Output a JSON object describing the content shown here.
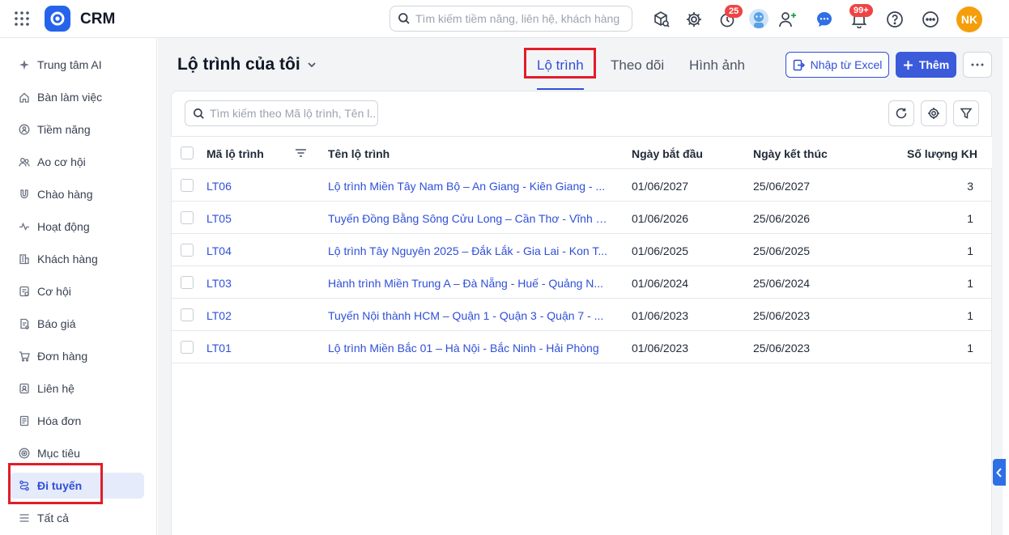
{
  "app": {
    "brand": "CRM"
  },
  "header": {
    "search_placeholder": "Tìm kiếm tiềm năng, liên hệ, khách hàng",
    "timer_badge": "25",
    "notification_badge": "99+",
    "user_initials": "NK"
  },
  "sidebar": {
    "items": [
      {
        "label": "Trung tâm AI",
        "icon": "sparkle-icon"
      },
      {
        "label": "Bàn làm việc",
        "icon": "home-icon"
      },
      {
        "label": "Tiềm năng",
        "icon": "target-person-icon"
      },
      {
        "label": "Ao cơ hội",
        "icon": "users-icon"
      },
      {
        "label": "Chào hàng",
        "icon": "magnet-icon"
      },
      {
        "label": "Hoạt động",
        "icon": "activity-icon"
      },
      {
        "label": "Khách hàng",
        "icon": "building-icon"
      },
      {
        "label": "Cơ hội",
        "icon": "opportunity-icon"
      },
      {
        "label": "Báo giá",
        "icon": "quote-icon"
      },
      {
        "label": "Đơn hàng",
        "icon": "cart-icon"
      },
      {
        "label": "Liên hệ",
        "icon": "contact-icon"
      },
      {
        "label": "Hóa đơn",
        "icon": "invoice-icon"
      },
      {
        "label": "Mục tiêu",
        "icon": "goal-icon"
      },
      {
        "label": "Đi tuyến",
        "icon": "route-icon",
        "active": true
      },
      {
        "label": "Tất cả",
        "icon": "menu-icon"
      }
    ]
  },
  "page": {
    "title": "Lộ trình của tôi",
    "tabs": [
      {
        "label": "Lộ trình",
        "active": true
      },
      {
        "label": "Theo dõi"
      },
      {
        "label": "Hình ảnh"
      }
    ],
    "import_label": "Nhập từ Excel",
    "add_label": "Thêm"
  },
  "table": {
    "search_placeholder": "Tìm kiếm theo Mã lộ trình, Tên l...",
    "columns": [
      "Mã lộ trình",
      "Tên lộ trình",
      "Ngày bắt đầu",
      "Ngày kết thúc",
      "Số lượng KH"
    ],
    "rows": [
      {
        "code": "LT06",
        "name": "Lộ trình Miền Tây Nam Bộ – An Giang - Kiên Giang - ...",
        "start": "01/06/2027",
        "end": "25/06/2027",
        "count": "3"
      },
      {
        "code": "LT05",
        "name": "Tuyến Đồng Bằng Sông Cửu Long – Cần Thơ - Vĩnh L...",
        "start": "01/06/2026",
        "end": "25/06/2026",
        "count": "1"
      },
      {
        "code": "LT04",
        "name": "Lộ trình Tây Nguyên 2025 – Đắk Lắk - Gia Lai - Kon T...",
        "start": "01/06/2025",
        "end": "25/06/2025",
        "count": "1"
      },
      {
        "code": "LT03",
        "name": "Hành trình Miền Trung A – Đà Nẵng - Huế - Quảng N...",
        "start": "01/06/2024",
        "end": "25/06/2024",
        "count": "1"
      },
      {
        "code": "LT02",
        "name": "Tuyến Nội thành HCM – Quận 1 - Quận 3 - Quận 7 - ...",
        "start": "01/06/2023",
        "end": "25/06/2023",
        "count": "1"
      },
      {
        "code": "LT01",
        "name": "Lộ trình Miền Bắc 01 – Hà Nội - Bắc Ninh - Hải Phòng",
        "start": "01/06/2023",
        "end": "25/06/2023",
        "count": "1"
      }
    ]
  },
  "colors": {
    "accent": "#2f4fd8",
    "highlight_box": "#e11d2a",
    "badge": "#ef4444",
    "avatar": "#f59e0b"
  }
}
